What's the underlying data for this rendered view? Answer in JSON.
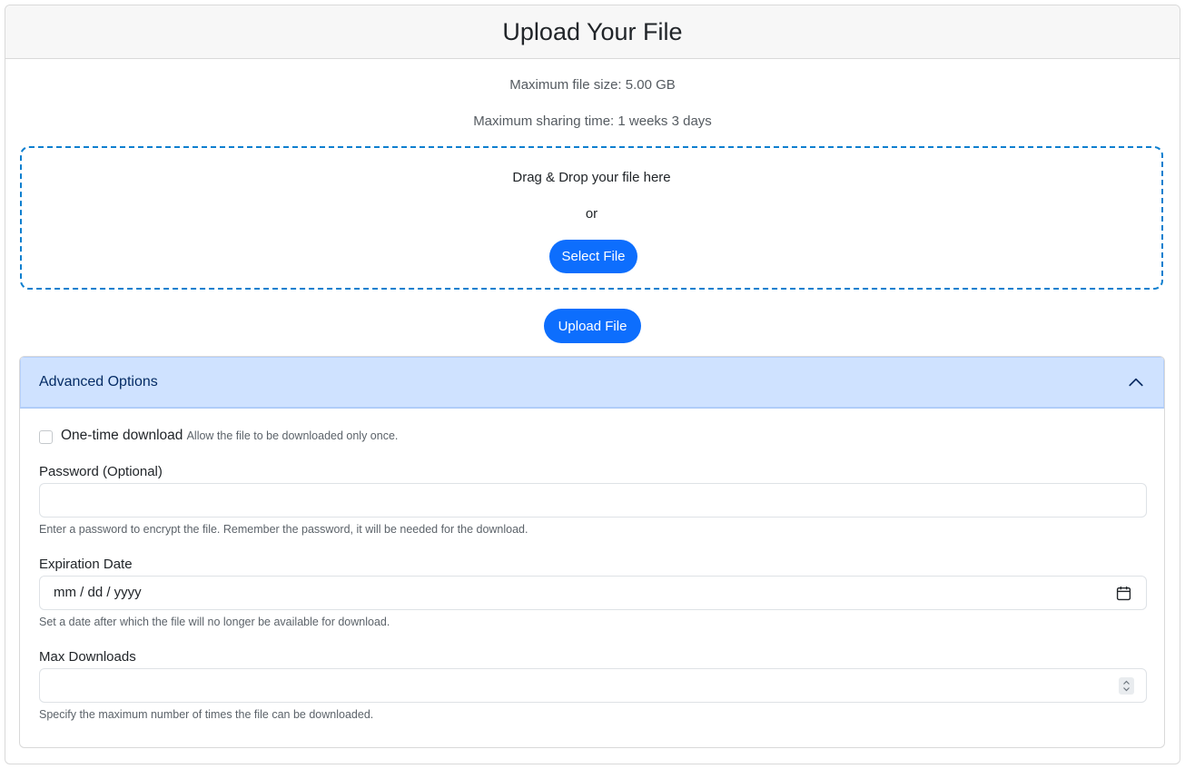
{
  "header": {
    "title": "Upload Your File"
  },
  "info": {
    "max_size": "Maximum file size: 5.00 GB",
    "max_time": "Maximum sharing time: 1 weeks 3 days"
  },
  "dropzone": {
    "text": "Drag & Drop your file here",
    "or": "or",
    "select_label": "Select File"
  },
  "upload_label": "Upload File",
  "advanced": {
    "title": "Advanced Options",
    "one_time": {
      "label": "One-time download",
      "help": "Allow the file to be downloaded only once.",
      "checked": false
    },
    "password": {
      "label": "Password (Optional)",
      "value": "",
      "help": "Enter a password to encrypt the file. Remember the password, it will be needed for the download."
    },
    "expiration": {
      "label": "Expiration Date",
      "placeholder": "mm / dd / yyyy",
      "help": "Set a date after which the file will no longer be available for download."
    },
    "max_downloads": {
      "label": "Max Downloads",
      "value": "",
      "help": "Specify the maximum number of times the file can be downloaded."
    }
  },
  "colors": {
    "primary": "#0d6efd",
    "dropzone_border": "#0d7fcf",
    "accordion_active": "#cfe2ff"
  },
  "icons": {
    "collapse": "chevron-up-icon",
    "calendar": "calendar-icon",
    "spinner": "spinner-icon"
  }
}
